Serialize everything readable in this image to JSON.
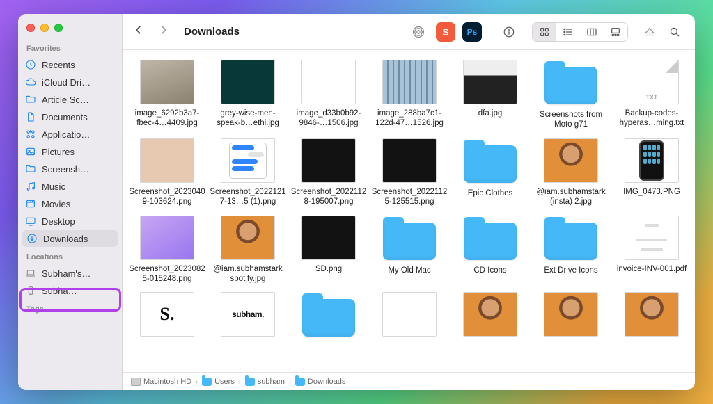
{
  "window": {
    "title": "Downloads"
  },
  "sidebar": {
    "favorites_header": "Favorites",
    "items": [
      {
        "label": "Recents",
        "icon": "clock"
      },
      {
        "label": "iCloud Dri…",
        "icon": "cloud"
      },
      {
        "label": "Article Sc…",
        "icon": "folder"
      },
      {
        "label": "Documents",
        "icon": "doc"
      },
      {
        "label": "Applicatio…",
        "icon": "apps"
      },
      {
        "label": "Pictures",
        "icon": "picture"
      },
      {
        "label": "Screensh…",
        "icon": "folder"
      },
      {
        "label": "Music",
        "icon": "music"
      },
      {
        "label": "Movies",
        "icon": "movie"
      },
      {
        "label": "Desktop",
        "icon": "desktop"
      },
      {
        "label": "Downloads",
        "icon": "download",
        "selected": true
      }
    ],
    "locations_header": "Locations",
    "locations": [
      {
        "label": "Subham's…",
        "icon": "laptop"
      },
      {
        "label": "Subha…",
        "icon": "phone"
      }
    ],
    "tags_header": "Tags"
  },
  "toolbar": {
    "app1_letter": "S",
    "app2_letter": "Ps"
  },
  "files": [
    {
      "name": "image_6292b3a7-fbec-4…4409.jpg",
      "thumb": "photo"
    },
    {
      "name": "grey-wise-men-speak-b…ethi.jpg",
      "thumb": "tealtext"
    },
    {
      "name": "image_d33b0b92-9846-…1506.jpg",
      "thumb": "white"
    },
    {
      "name": "image_288ba7c1-122d-47…1526.jpg",
      "thumb": "building"
    },
    {
      "name": "dfa.jpg",
      "thumb": "cat"
    },
    {
      "name": "Screenshots from Moto g71",
      "thumb": "folder"
    },
    {
      "name": "Backup-codes-hyperas…ming.txt",
      "thumb": "doc-txt",
      "badge": "TXT"
    },
    {
      "name": "Screenshot_20230409-103624.png",
      "thumb": "skin"
    },
    {
      "name": "Screenshot_20221217-13…5 (1).png",
      "thumb": "msgs"
    },
    {
      "name": "Screenshot_20221128-195007.png",
      "thumb": "dark"
    },
    {
      "name": "Screenshot_20221125-125515.png",
      "thumb": "dark"
    },
    {
      "name": "Epic Clothes",
      "thumb": "folder"
    },
    {
      "name": "@iam.subhamstark (insta) 2.jpg",
      "thumb": "portrait"
    },
    {
      "name": "IMG_0473.PNG",
      "thumb": "phone"
    },
    {
      "name": "Screenshot_20230825-015248.png",
      "thumb": "gradient"
    },
    {
      "name": "@iam.subhamstark spotify.jpg",
      "thumb": "portrait"
    },
    {
      "name": "SD.png",
      "thumb": "dark"
    },
    {
      "name": "My Old Mac",
      "thumb": "folder"
    },
    {
      "name": "CD Icons",
      "thumb": "folder"
    },
    {
      "name": "Ext Drive Icons",
      "thumb": "folder"
    },
    {
      "name": "invoice-INV-001.pdf",
      "thumb": "invoice"
    },
    {
      "name": "",
      "thumb": "bigS"
    },
    {
      "name": "",
      "thumb": "subham"
    },
    {
      "name": "",
      "thumb": "folder"
    },
    {
      "name": "",
      "thumb": "white"
    },
    {
      "name": "",
      "thumb": "portrait"
    },
    {
      "name": "",
      "thumb": "portrait"
    },
    {
      "name": "",
      "thumb": "portrait"
    }
  ],
  "pathbar": {
    "segments": [
      {
        "label": "Macintosh HD",
        "icon": "hd"
      },
      {
        "label": "Users",
        "icon": "folder"
      },
      {
        "label": "subham",
        "icon": "folder"
      },
      {
        "label": "Downloads",
        "icon": "folder"
      }
    ]
  }
}
